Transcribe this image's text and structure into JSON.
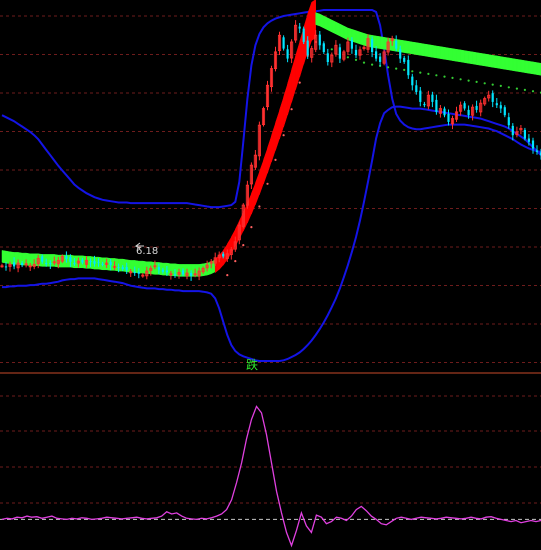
{
  "chart_data": [
    {
      "type": "candlestick",
      "title": "",
      "annotations": {
        "low_marker": "6.18",
        "signal": "跌"
      },
      "colors": {
        "up": "#ff3030",
        "down": "#00e5ff",
        "upper_band": "#1414e6",
        "lower_band": "#1414e6",
        "ribbon_up": "#ff0000",
        "ribbon_down": "#33ff33",
        "grid": "#6e1c1c",
        "dots": "#ff6060",
        "dots_down": "#33cc33"
      },
      "n": 135,
      "candles_close": [
        6.34,
        6.32,
        6.36,
        6.33,
        6.38,
        6.35,
        6.37,
        6.34,
        6.36,
        6.45,
        6.4,
        6.38,
        6.37,
        6.4,
        6.42,
        6.48,
        6.44,
        6.4,
        6.38,
        6.41,
        6.39,
        6.42,
        6.4,
        6.37,
        6.39,
        6.36,
        6.38,
        6.35,
        6.33,
        6.31,
        6.29,
        6.27,
        6.25,
        6.23,
        6.22,
        6.2,
        6.26,
        6.3,
        6.34,
        6.28,
        6.25,
        6.24,
        6.22,
        6.2,
        6.24,
        6.21,
        6.23,
        6.19,
        6.22,
        6.26,
        6.3,
        6.35,
        6.4,
        6.46,
        6.5,
        6.48,
        6.52,
        6.58,
        6.7,
        6.95,
        7.25,
        7.55,
        7.85,
        8.0,
        8.45,
        8.7,
        9.05,
        9.3,
        9.55,
        9.8,
        9.6,
        9.45,
        9.7,
        9.95,
        9.9,
        9.7,
        9.5,
        9.6,
        9.8,
        9.65,
        9.55,
        9.4,
        9.5,
        9.65,
        9.45,
        9.55,
        9.7,
        9.6,
        9.5,
        9.58,
        9.62,
        9.75,
        9.55,
        9.45,
        9.4,
        9.55,
        9.7,
        9.75,
        9.6,
        9.45,
        9.4,
        9.2,
        9.05,
        8.95,
        8.8,
        8.75,
        8.9,
        8.8,
        8.65,
        8.7,
        8.6,
        8.5,
        8.55,
        8.65,
        8.75,
        8.7,
        8.6,
        8.72,
        8.68,
        8.78,
        8.85,
        8.9,
        8.8,
        8.75,
        8.7,
        8.6,
        8.45,
        8.3,
        8.35,
        8.4,
        8.25,
        8.2,
        8.1,
        8.05,
        8.0
      ],
      "upper_band": [
        8.6,
        8.57,
        8.54,
        8.51,
        8.47,
        8.43,
        8.39,
        8.35,
        8.3,
        8.24,
        8.16,
        8.08,
        8.0,
        7.92,
        7.84,
        7.77,
        7.7,
        7.63,
        7.56,
        7.51,
        7.47,
        7.43,
        7.4,
        7.37,
        7.35,
        7.33,
        7.32,
        7.31,
        7.3,
        7.29,
        7.29,
        7.29,
        7.28,
        7.28,
        7.28,
        7.28,
        7.28,
        7.28,
        7.28,
        7.28,
        7.28,
        7.28,
        7.28,
        7.28,
        7.28,
        7.28,
        7.28,
        7.27,
        7.26,
        7.25,
        7.24,
        7.23,
        7.22,
        7.22,
        7.22,
        7.23,
        7.24,
        7.25,
        7.3,
        7.6,
        8.2,
        8.85,
        9.35,
        9.65,
        9.82,
        9.92,
        9.98,
        10.02,
        10.05,
        10.07,
        10.09,
        10.1,
        10.11,
        10.12,
        10.13,
        10.14,
        10.15,
        10.16,
        10.16,
        10.17,
        10.18,
        10.18,
        10.18,
        10.18,
        10.18,
        10.18,
        10.18,
        10.18,
        10.18,
        10.18,
        10.18,
        10.18,
        10.18,
        10.15,
        9.95,
        9.6,
        9.2,
        8.85,
        8.62,
        8.52,
        8.46,
        8.42,
        8.4,
        8.39,
        8.39,
        8.4,
        8.41,
        8.42,
        8.43,
        8.44,
        8.45,
        8.46,
        8.46,
        8.46,
        8.46,
        8.46,
        8.45,
        8.44,
        8.43,
        8.42,
        8.41,
        8.4,
        8.38,
        8.36,
        8.33,
        8.3,
        8.27,
        8.24,
        8.2,
        8.16,
        8.13,
        8.1,
        8.08,
        8.06,
        8.05
      ],
      "lower_band": [
        6.02,
        6.02,
        6.03,
        6.03,
        6.04,
        6.04,
        6.04,
        6.05,
        6.05,
        6.06,
        6.07,
        6.07,
        6.08,
        6.09,
        6.1,
        6.12,
        6.13,
        6.14,
        6.14,
        6.15,
        6.15,
        6.15,
        6.15,
        6.15,
        6.14,
        6.13,
        6.12,
        6.11,
        6.1,
        6.09,
        6.08,
        6.06,
        6.04,
        6.03,
        6.02,
        6.01,
        6.0,
        6.0,
        6.0,
        5.99,
        5.99,
        5.98,
        5.98,
        5.97,
        5.97,
        5.96,
        5.96,
        5.96,
        5.96,
        5.96,
        5.95,
        5.94,
        5.92,
        5.85,
        5.7,
        5.5,
        5.3,
        5.15,
        5.06,
        5.01,
        4.98,
        4.96,
        4.94,
        4.92,
        4.91,
        4.91,
        4.91,
        4.91,
        4.91,
        4.91,
        4.92,
        4.94,
        4.97,
        5.0,
        5.04,
        5.09,
        5.15,
        5.22,
        5.3,
        5.39,
        5.49,
        5.6,
        5.72,
        5.85,
        6.0,
        6.17,
        6.35,
        6.55,
        6.77,
        7.02,
        7.3,
        7.6,
        7.92,
        8.25,
        8.48,
        8.63,
        8.68,
        8.72,
        8.73,
        8.73,
        8.72,
        8.71,
        8.7,
        8.7,
        8.7,
        8.69,
        8.68,
        8.67,
        8.66,
        8.65,
        8.64,
        8.63,
        8.62,
        8.61,
        8.6,
        8.59,
        8.58,
        8.57,
        8.56,
        8.55,
        8.53,
        8.51,
        8.49,
        8.47,
        8.45,
        8.43,
        8.4,
        8.36,
        8.32,
        8.28,
        8.24,
        8.18,
        8.12,
        8.06,
        8.0
      ],
      "ribbon_mid": [
        6.48,
        6.47,
        6.46,
        6.45,
        6.45,
        6.44,
        6.44,
        6.43,
        6.43,
        6.43,
        6.42,
        6.42,
        6.42,
        6.42,
        6.41,
        6.41,
        6.41,
        6.41,
        6.4,
        6.4,
        6.4,
        6.39,
        6.39,
        6.38,
        6.38,
        6.37,
        6.37,
        6.36,
        6.36,
        6.35,
        6.35,
        6.34,
        6.33,
        6.33,
        6.32,
        6.32,
        6.31,
        6.31,
        6.3,
        6.3,
        6.29,
        6.29,
        6.28,
        6.28,
        6.27,
        6.27,
        6.27,
        6.27,
        6.27,
        6.27,
        6.28,
        6.29,
        6.31,
        6.34,
        6.39,
        6.46,
        6.55,
        6.65,
        6.76,
        6.88,
        7.0,
        7.13,
        7.27,
        7.42,
        7.58,
        7.75,
        7.92,
        8.1,
        8.28,
        8.46,
        8.65,
        8.84,
        9.04,
        9.24,
        9.44,
        9.64,
        9.84,
        10.01,
        10.05,
        10.03,
        10.0,
        9.97,
        9.94,
        9.91,
        9.88,
        9.85,
        9.82,
        9.8,
        9.78,
        9.76,
        9.74,
        9.72,
        9.71,
        9.7,
        9.69,
        9.68,
        9.67,
        9.66,
        9.65,
        9.64,
        9.63,
        9.62,
        9.61,
        9.6,
        9.59,
        9.58,
        9.57,
        9.56,
        9.55,
        9.54,
        9.53,
        9.52,
        9.51,
        9.5,
        9.49,
        9.48,
        9.47,
        9.46,
        9.45,
        9.44,
        9.43,
        9.42,
        9.41,
        9.4,
        9.39,
        9.38,
        9.37,
        9.36,
        9.35,
        9.34,
        9.33,
        9.32,
        9.31,
        9.3,
        9.29
      ]
    },
    {
      "type": "line",
      "title": "",
      "colors": {
        "line": "#e040e0",
        "zero": "#c8c8c8",
        "grid": "#6e1c1c"
      },
      "values": [
        0,
        0.1,
        0.05,
        0.2,
        0.15,
        0.3,
        0.2,
        0.25,
        0.1,
        0.2,
        0.3,
        0.1,
        0.05,
        0,
        0.1,
        0.05,
        0.15,
        0.1,
        0,
        0.05,
        0.1,
        0.2,
        0.15,
        0.1,
        0.05,
        0.1,
        0.15,
        0.2,
        0.1,
        0.05,
        0.1,
        0.15,
        0.3,
        0.7,
        0.5,
        0.6,
        0.3,
        0.1,
        0.05,
        0,
        0.1,
        0.05,
        0.15,
        0.3,
        0.5,
        0.9,
        1.8,
        3.4,
        5.2,
        7.4,
        9.2,
        10.4,
        9.8,
        7.8,
        5.2,
        2.6,
        0.6,
        -1.2,
        -2.4,
        -1.0,
        0.6,
        -0.6,
        -1.2,
        0.4,
        0.2,
        -0.4,
        -0.2,
        0.2,
        0.1,
        -0.1,
        0.3,
        0.9,
        1.2,
        0.8,
        0.3,
        0,
        -0.4,
        -0.5,
        -0.2,
        0.1,
        0.2,
        0.1,
        0,
        0.1,
        0.2,
        0.15,
        0.1,
        0.05,
        0.1,
        0.2,
        0.15,
        0.1,
        0.05,
        0.1,
        0.2,
        0.1,
        0.05,
        0.2,
        0.25,
        0.1,
        0,
        -0.1,
        -0.2,
        -0.1,
        -0.3,
        -0.2,
        -0.1,
        -0.2,
        -0.1
      ],
      "ylim": [
        -3,
        12
      ]
    }
  ]
}
